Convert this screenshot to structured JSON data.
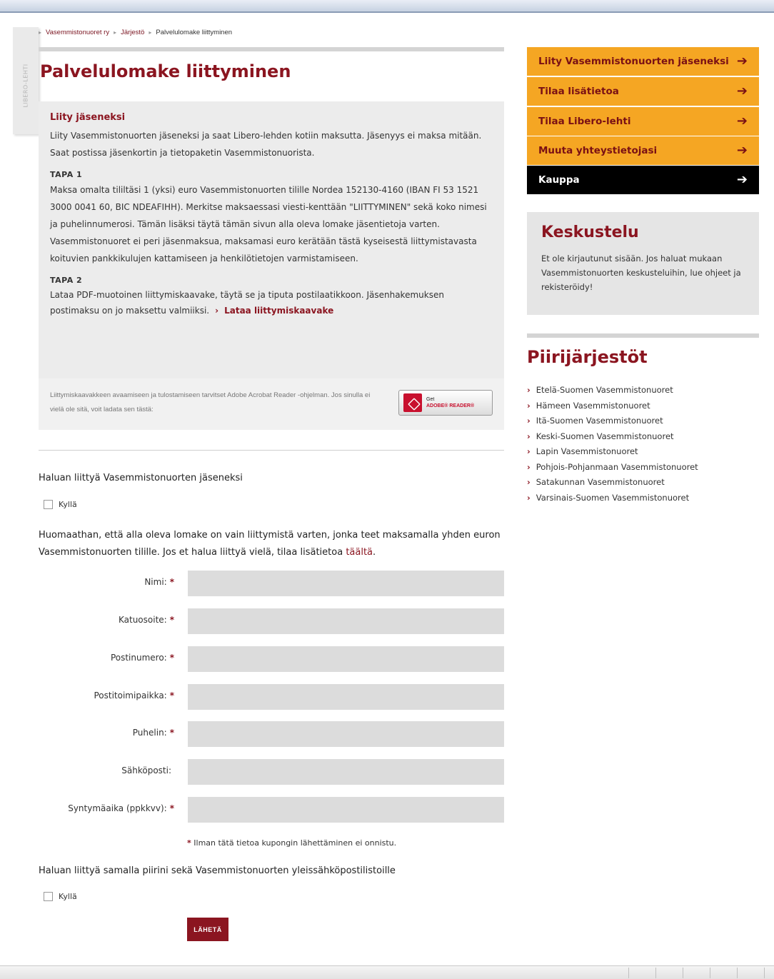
{
  "side_tab": {
    "label": "LIBERO-LEHTI"
  },
  "breadcrumb": [
    "Vasemmistonuoret ry",
    "Järjestö",
    "Palvelulomake liittyminen"
  ],
  "page_title": "Palvelulomake liittyminen",
  "info": {
    "heading": "Liity jäseneksi",
    "intro": "Liity Vasemmistonuorten jäseneksi ja saat Libero-lehden kotiin maksutta. Jäsenyys ei maksa mitään. Saat postissa jäsenkortin ja tietopaketin Vasemmistonuorista.",
    "tapa1_title": "TAPA 1",
    "tapa1_text": "Maksa omalta tililtäsi 1 (yksi) euro Vasemmistonuorten tilille Nordea 152130-4160 (IBAN FI 53 1521 3000 0041 60, BIC NDEAFIHH). Merkitse maksaessasi viesti-kenttään \"LIITTYMINEN\" sekä koko nimesi ja puhelinnumerosi. Tämän lisäksi täytä tämän sivun alla oleva lomake jäsentietoja varten. Vasemmistonuoret ei peri jäsenmaksua, maksamasi euro kerätään tästä kyseisestä liittymistavasta koituvien pankkikulujen kattamiseen ja henkilötietojen varmistamiseen.",
    "tapa2_title": "TAPA 2",
    "tapa2_text": "Lataa PDF-muotoinen liittymiskaavake, täytä se ja tiputa postilaatikkoon. Jäsenhakemuksen postimaksu on jo maksettu valmiiksi.",
    "tapa2_link": "Lataa liittymiskaavake",
    "adobe_note": "Liittymiskaavakkeen avaamiseen ja tulostamiseen tarvitset Adobe Acrobat Reader -ohjelman. Jos sinulla ei vielä ole sitä, voit ladata sen tästä:",
    "adobe_get": "Get",
    "adobe_brand": "ADOBE® READER®"
  },
  "form": {
    "join_question": "Haluan liittyä Vasemmistonuorten jäseneksi",
    "yes_label": "Kyllä",
    "note_text": "Huomaathan, että alla oleva lomake on vain liittymistä varten, jonka teet maksamalla yhden euron Vasemmistonuorten tilille. Jos et halua liittyä vielä, tilaa lisätietoa",
    "note_link": "täältä",
    "fields": [
      {
        "label": "Nimi:",
        "required": "*"
      },
      {
        "label": "Katuosoite:",
        "required": "*"
      },
      {
        "label": "Postinumero:",
        "required": "*"
      },
      {
        "label": "Postitoimipaikka:",
        "required": "*"
      },
      {
        "label": "Puhelin:",
        "required": "*"
      },
      {
        "label": "Sähköposti:",
        "required": ""
      },
      {
        "label": "Syntymäaika (ppkkvv):",
        "required": "*"
      }
    ],
    "required_note_star": "*",
    "required_note": "Ilman tätä tietoa kupongin lähettäminen ei onnistu.",
    "list_question": "Haluan liittyä samalla piirini sekä Vasemmistonuorten yleissähköpostilistoille",
    "yes_label2": "Kyllä",
    "submit_label": "LÄHETÄ"
  },
  "actions": [
    {
      "label": "Liity Vasemmistonuorten jäseneksi",
      "arrow": "➔"
    },
    {
      "label": "Tilaa lisätietoa",
      "arrow": "➔"
    },
    {
      "label": "Tilaa Libero-lehti",
      "arrow": "➔"
    },
    {
      "label": "Muuta yhteystietojasi",
      "arrow": "➔"
    },
    {
      "label": "Kauppa",
      "arrow": "➔"
    }
  ],
  "keskustelu": {
    "title": "Keskustelu",
    "text": "Et ole kirjautunut sisään. Jos haluat mukaan Vasemmistonuorten keskusteluihin, lue ohjeet ja rekisteröidy!"
  },
  "piirit": {
    "title": "Piirijärjestöt",
    "items": [
      "Etelä-Suomen Vasemmistonuoret",
      "Hämeen Vasemmistonuoret",
      "Itä-Suomen Vasemmistonuoret",
      "Keski-Suomen Vasemmistonuoret",
      "Lapin Vasemmistonuoret",
      "Pohjois-Pohjanmaan Vasemmistonuoret",
      "Satakunnan Vasemmistonuoret",
      "Varsinais-Suomen Vasemmistonuoret"
    ]
  },
  "colors": {
    "brand": "#8b1520",
    "orange": "#f5a623",
    "field": "#dcdcdc"
  }
}
